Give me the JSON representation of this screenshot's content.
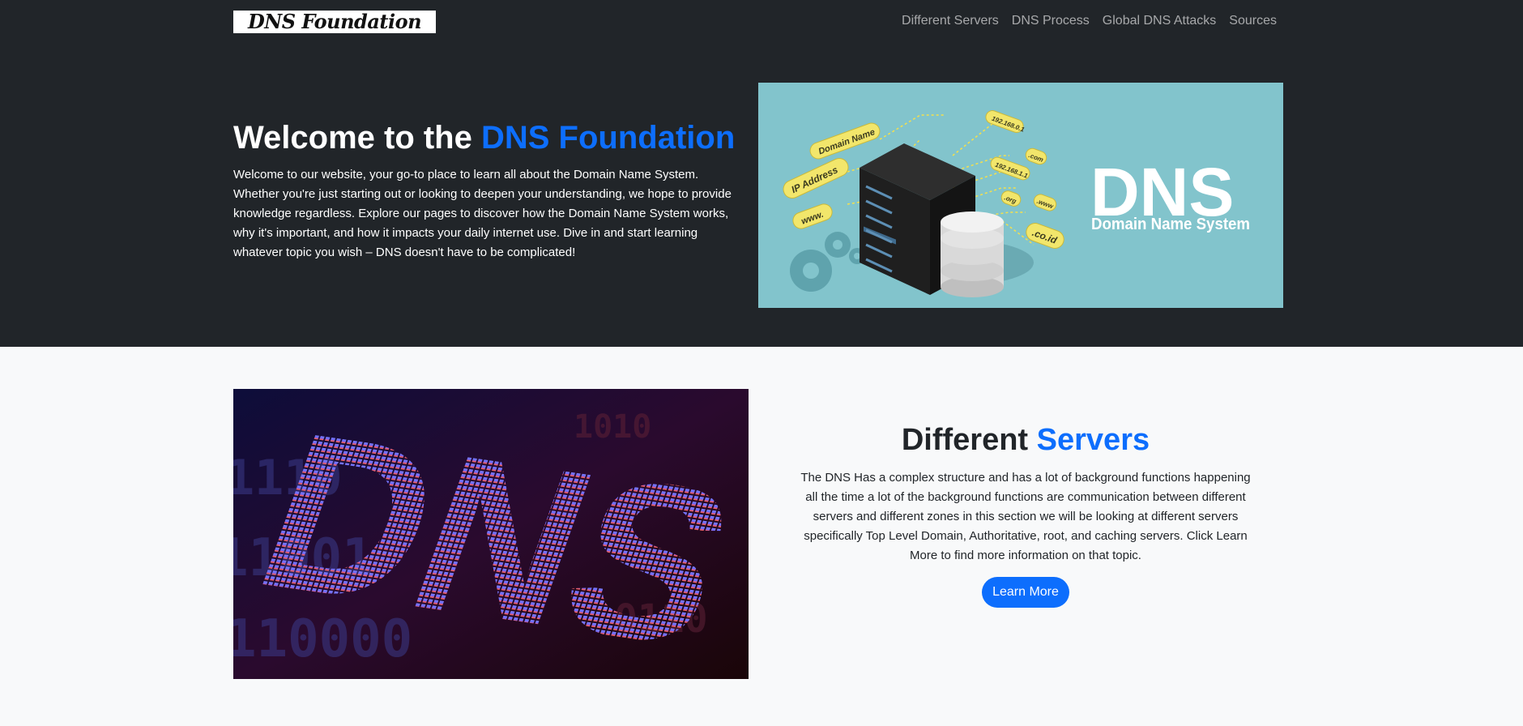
{
  "brand": "DNS Foundation",
  "nav": [
    {
      "label": "Different Servers"
    },
    {
      "label": "DNS Process"
    },
    {
      "label": "Global DNS Attacks"
    },
    {
      "label": "Sources"
    }
  ],
  "hero": {
    "title_prefix": "Welcome to the ",
    "title_accent": "DNS Foundation",
    "body": "Welcome to our website, your go-to place to learn all about the Domain Name System. Whether you're just starting out or looking to deepen your understanding, we hope to provide knowledge regardless. Explore our pages to discover how the Domain Name System works, why it's important, and how it impacts your daily internet use. Dive in and start learning whatever topic you wish – DNS doesn't have to be complicated!",
    "image": {
      "big_text": "DNS",
      "sub_text": "Domain Name System",
      "tags": [
        "Domain Name",
        "IP Address",
        "www.",
        "192.168.0.1",
        ".com",
        "192.168.1.1",
        ".org",
        ".www",
        ".co.id"
      ]
    }
  },
  "servers": {
    "title_prefix": "Different ",
    "title_accent": "Servers",
    "body": "The DNS Has a complex structure and has a lot of background functions happening all the time a lot of the background functions are communication between different servers and different zones in this section we will be looking at different servers specifically Top Level Domain, Authoritative, root, and caching servers. Click Learn More to find more information on that topic.",
    "button": "Learn More",
    "image_text": "DNS"
  },
  "colors": {
    "dark": "#212529",
    "accent": "#0d6efd",
    "light": "#f8f9fa",
    "teal": "#82c4cc"
  }
}
